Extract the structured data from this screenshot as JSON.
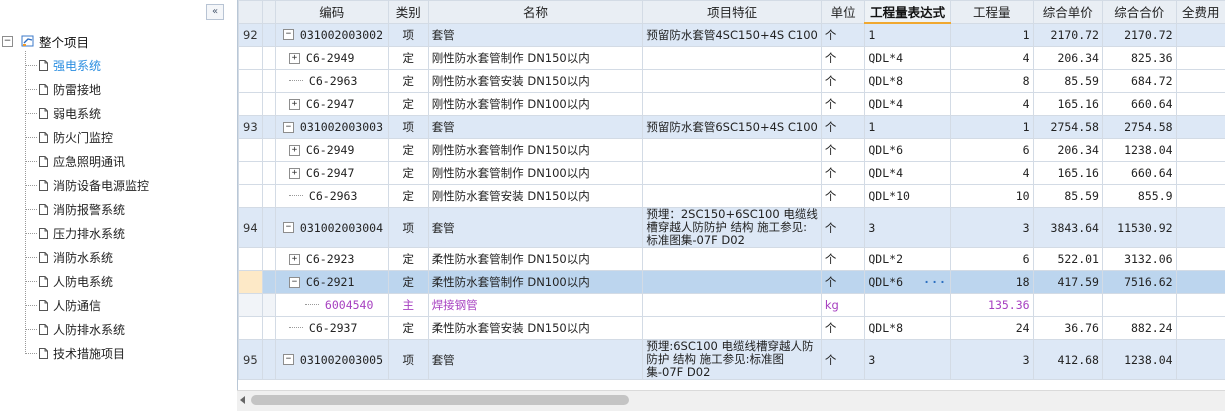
{
  "tree": {
    "collapse_glyph": "«",
    "root": {
      "toggle": "−",
      "label": "整个项目",
      "icon": "project-folder-icon"
    },
    "items": [
      {
        "label": "强电系统",
        "selected": true
      },
      {
        "label": "防雷接地"
      },
      {
        "label": "弱电系统"
      },
      {
        "label": "防火门监控"
      },
      {
        "label": "应急照明通讯"
      },
      {
        "label": "消防设备电源监控"
      },
      {
        "label": "消防报警系统"
      },
      {
        "label": "压力排水系统"
      },
      {
        "label": "消防水系统"
      },
      {
        "label": "人防电系统"
      },
      {
        "label": "人防通信"
      },
      {
        "label": "人防排水系统"
      },
      {
        "label": "技术措施项目"
      }
    ]
  },
  "grid": {
    "headers": {
      "rownum": "",
      "tree": "",
      "code": "编码",
      "type": "类别",
      "name": "名称",
      "feature": "项目特征",
      "unit": "单位",
      "expr": "工程量表达式",
      "qty": "工程量",
      "unit_price": "综合单价",
      "total_price": "综合合价",
      "full_fee": "全费用"
    },
    "rows": [
      {
        "kind": "xiang",
        "num": "92",
        "toggle": "−",
        "code": "031002003002",
        "type": "项",
        "name": "套管",
        "feature": "预留防水套管4SC150+4S C100",
        "unit": "个",
        "expr": "1",
        "qty": "1",
        "up": "2170.72",
        "tp": "2170.72"
      },
      {
        "kind": "ding",
        "num": "",
        "toggle": "+",
        "code": "C6-2949",
        "type": "定",
        "name": "刚性防水套管制作 DN150以内",
        "feature": "",
        "unit": "个",
        "expr": "QDL*4",
        "qty": "4",
        "up": "206.34",
        "tp": "825.36"
      },
      {
        "kind": "ding",
        "num": "",
        "toggle": "",
        "code": "C6-2963",
        "type": "定",
        "name": "刚性防水套管安装 DN150以内",
        "feature": "",
        "unit": "个",
        "expr": "QDL*8",
        "qty": "8",
        "up": "85.59",
        "tp": "684.72"
      },
      {
        "kind": "ding",
        "num": "",
        "toggle": "+",
        "code": "C6-2947",
        "type": "定",
        "name": "刚性防水套管制作 DN100以内",
        "feature": "",
        "unit": "个",
        "expr": "QDL*4",
        "qty": "4",
        "up": "165.16",
        "tp": "660.64"
      },
      {
        "kind": "xiang",
        "num": "93",
        "toggle": "−",
        "code": "031002003003",
        "type": "项",
        "name": "套管",
        "feature": "预留防水套管6SC150+4S C100",
        "unit": "个",
        "expr": "1",
        "qty": "1",
        "up": "2754.58",
        "tp": "2754.58"
      },
      {
        "kind": "ding",
        "num": "",
        "toggle": "+",
        "code": "C6-2949",
        "type": "定",
        "name": "刚性防水套管制作 DN150以内",
        "feature": "",
        "unit": "个",
        "expr": "QDL*6",
        "qty": "6",
        "up": "206.34",
        "tp": "1238.04"
      },
      {
        "kind": "ding",
        "num": "",
        "toggle": "+",
        "code": "C6-2947",
        "type": "定",
        "name": "刚性防水套管制作 DN100以内",
        "feature": "",
        "unit": "个",
        "expr": "QDL*4",
        "qty": "4",
        "up": "165.16",
        "tp": "660.64"
      },
      {
        "kind": "ding",
        "num": "",
        "toggle": "",
        "code": "C6-2963",
        "type": "定",
        "name": "刚性防水套管安装 DN150以内",
        "feature": "",
        "unit": "个",
        "expr": "QDL*10",
        "qty": "10",
        "up": "85.59",
        "tp": "855.9"
      },
      {
        "kind": "xiang",
        "tall": true,
        "num": "94",
        "toggle": "−",
        "code": "031002003004",
        "type": "项",
        "name": "套管",
        "feature": "预埋：2SC150+6SC100 电缆线槽穿越人防防护 结构 施工参见:标准图集-07F D02",
        "unit": "个",
        "expr": "3",
        "qty": "3",
        "up": "3843.64",
        "tp": "11530.92"
      },
      {
        "kind": "ding",
        "num": "",
        "toggle": "+",
        "code": "C6-2923",
        "type": "定",
        "name": "柔性防水套管制作 DN150以内",
        "feature": "",
        "unit": "个",
        "expr": "QDL*2",
        "qty": "6",
        "up": "522.01",
        "tp": "3132.06"
      },
      {
        "kind": "ding",
        "selected": true,
        "num": "",
        "toggle": "−",
        "code": "C6-2921",
        "type": "定",
        "name": "柔性防水套管制作 DN100以内",
        "feature": "",
        "unit": "个",
        "expr": "QDL*6",
        "editing": true,
        "qty": "18",
        "up": "417.59",
        "tp": "7516.62"
      },
      {
        "kind": "zhu",
        "num": "",
        "toggle": "",
        "code": "6004540",
        "type": "主",
        "name": "焊接钢管",
        "feature": "",
        "unit": "kg",
        "expr": "",
        "qty": "135.36",
        "up": "",
        "tp": ""
      },
      {
        "kind": "ding",
        "num": "",
        "toggle": "",
        "code": "C6-2937",
        "type": "定",
        "name": "柔性防水套管安装 DN150以内",
        "feature": "",
        "unit": "个",
        "expr": "QDL*8",
        "qty": "24",
        "up": "36.76",
        "tp": "882.24"
      },
      {
        "kind": "xiang",
        "tall": true,
        "num": "95",
        "toggle": "−",
        "code": "031002003005",
        "type": "项",
        "name": "套管",
        "feature": "预埋:6SC100 电缆线槽穿越人防防护 结构 施工参见:标准图集-07F D02",
        "unit": "个",
        "expr": "3",
        "qty": "3",
        "up": "412.68",
        "tp": "1238.04"
      }
    ],
    "edit_button": "···"
  },
  "colors": {
    "selected_row": "#bcd5ee",
    "item_row": "#dde8f6",
    "material_text": "#a63fc0",
    "active_header_underline": "#f0a830"
  }
}
